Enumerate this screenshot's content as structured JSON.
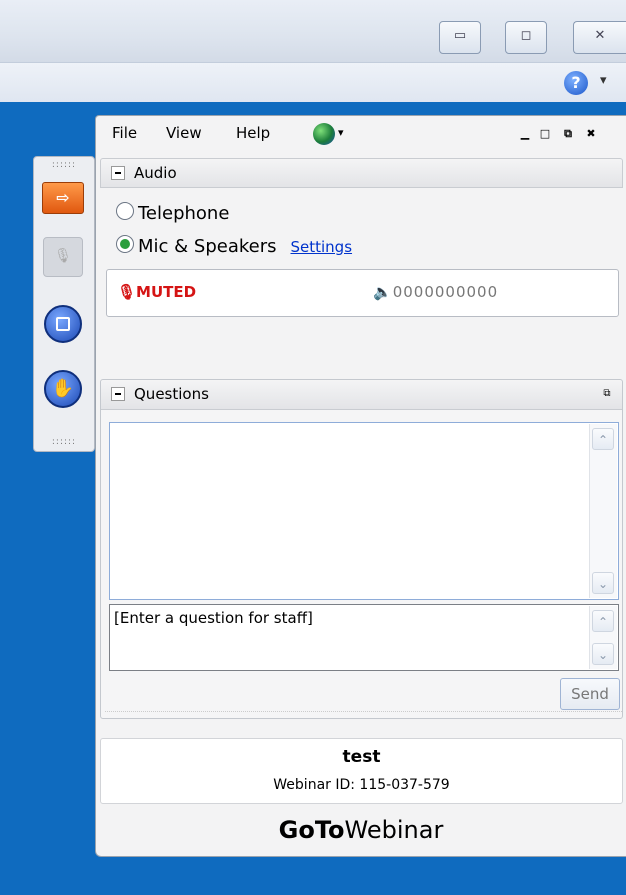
{
  "window": {
    "minimize_glyph": "▭",
    "maximize_glyph": "◻",
    "close_glyph": "✕"
  },
  "toolbar": {
    "help_glyph": "?",
    "help_caret": "▾"
  },
  "dock": {
    "grip": "::::::",
    "items": [
      {
        "icon": "orange-arrow-icon",
        "glyph": "⇨"
      },
      {
        "icon": "microphone-icon",
        "glyph": "🎙"
      },
      {
        "icon": "screen-share-icon"
      },
      {
        "icon": "raise-hand-icon",
        "glyph": "✋"
      }
    ]
  },
  "menubar": {
    "items": [
      "File",
      "View",
      "Help"
    ],
    "globe_caret": "▾",
    "controls": [
      "▁",
      "□",
      "⧉",
      "✖"
    ]
  },
  "audio": {
    "header": "Audio",
    "options": [
      {
        "label": "Telephone",
        "selected": false
      },
      {
        "label": "Mic & Speakers",
        "selected": true
      }
    ],
    "settings_link": "Settings",
    "mute_status": "MUTED",
    "mic_glyph": "🎙",
    "speaker_glyph": "🔈",
    "volume_level": "0000000000"
  },
  "questions": {
    "header": "Questions",
    "popout_glyph": "⧉",
    "input_placeholder": "[Enter a question for staff]",
    "send_label": "Send",
    "scroll_up": "⌃",
    "scroll_down": "⌄"
  },
  "webinar": {
    "title": "test",
    "id_text": "Webinar ID: 115-037-579"
  },
  "brand": {
    "bold": "GoTo",
    "regular": "Webinar"
  }
}
